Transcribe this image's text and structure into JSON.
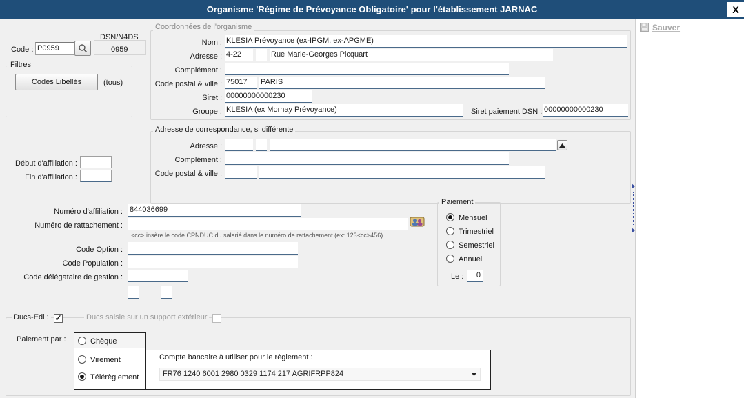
{
  "window": {
    "title": "Organisme 'Régime de Prévoyance Obligatoire' pour l'établissement JARNAC",
    "close": "X"
  },
  "toolbar": {
    "save": "Sauver"
  },
  "code": {
    "label": "Code :",
    "value": "P0959",
    "dsn_label": "DSN/N4DS",
    "dsn_value": "0959"
  },
  "filtres": {
    "title": "Filtres",
    "button": "Codes Libellés",
    "scope": "(tous)"
  },
  "coordonnees": {
    "title": "Coordonnées de l'organisme",
    "nom_label": "Nom :",
    "nom": "KLESIA Prévoyance (ex-IPGM, ex-APGME)",
    "adresse_label": "Adresse :",
    "adresse_num": "4-22",
    "adresse_rue": "Rue Marie-Georges Picquart",
    "complement_label": "Complément :",
    "cp_label": "Code postal & ville :",
    "cp": "75017",
    "ville": "PARIS",
    "siret_label": "Siret :",
    "siret": "00000000000230",
    "groupe_label": "Groupe :",
    "groupe": "KLESIA (ex Mornay Prévoyance)",
    "siret_dsn_label": "Siret paiement DSN :",
    "siret_dsn": "00000000000230"
  },
  "correspondance": {
    "title": "Adresse de correspondance, si différente",
    "adresse_label": "Adresse :",
    "complement_label": "Complément :",
    "cp_label": "Code postal & ville :"
  },
  "affiliation": {
    "debut_label": "Début d'affiliation :",
    "fin_label": "Fin d'affiliation :",
    "numero_label": "Numéro d'affiliation :",
    "numero": "844036699",
    "rattachement_label": "Numéro de rattachement :",
    "hint": "<cc> insère le code CPNDUC du salarié dans le numéro de rattachement (ex: 123<cc>456)",
    "option_label": "Code Option :",
    "population_label": "Code Population :",
    "delegataire_label": "Code délégataire de gestion :"
  },
  "paiement": {
    "title": "Paiement",
    "options": [
      "Mensuel",
      "Trimestriel",
      "Semestriel",
      "Annuel"
    ],
    "le_label": "Le :",
    "le_value": "0"
  },
  "ducs": {
    "label": "Ducs-Edi :",
    "checked": "✓",
    "support_label": "Ducs saisie sur un support extérieur"
  },
  "paiement_par": {
    "label": "Paiement par :",
    "options": [
      "Chèque",
      "Virement",
      "Télérèglement"
    ],
    "compte_label": "Compte bancaire à utiliser pour le règlement :",
    "compte": "FR76 1240 6001 2980 0329 1174 217  AGRIFRPP824"
  }
}
